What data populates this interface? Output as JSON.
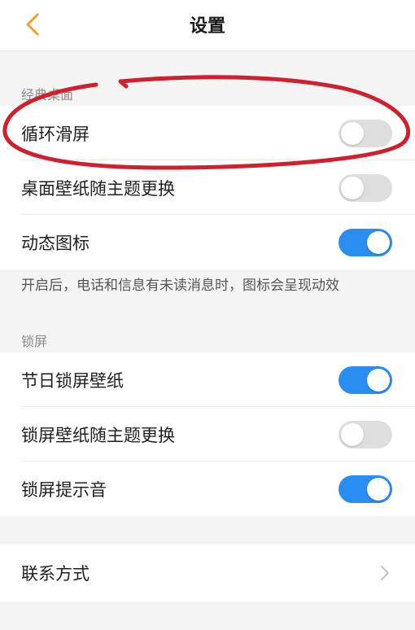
{
  "header": {
    "title": "设置",
    "back_icon": "chevron-left-icon",
    "accent_color": "#f0a030"
  },
  "sections": {
    "desktop": {
      "label": "经典桌面",
      "items": [
        {
          "label": "循环滑屏",
          "on": false
        },
        {
          "label": "桌面壁纸随主题更换",
          "on": false
        },
        {
          "label": "动态图标",
          "on": true
        }
      ],
      "note": "开启后，电话和信息有未读消息时，图标会呈现动效"
    },
    "lockscreen": {
      "label": "锁屏",
      "items": [
        {
          "label": "节日锁屏壁纸",
          "on": true
        },
        {
          "label": "锁屏壁纸随主题更换",
          "on": false
        },
        {
          "label": "锁屏提示音",
          "on": true
        }
      ]
    },
    "contact": {
      "label": "联系方式",
      "icon": "chevron-right-icon"
    }
  },
  "colors": {
    "toggle_on": "#2a8df2",
    "toggle_off": "#dedede",
    "annotation": "#d0202e"
  }
}
